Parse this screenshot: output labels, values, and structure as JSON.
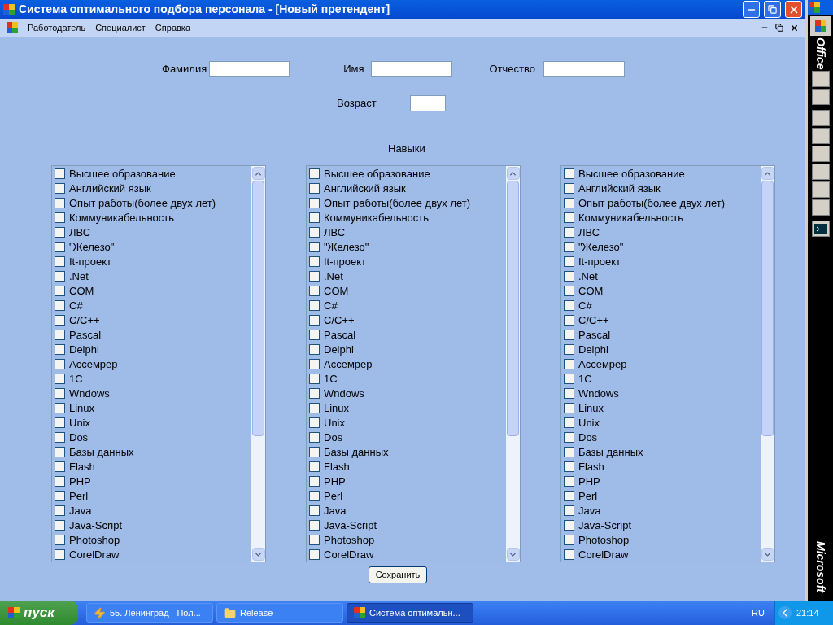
{
  "window": {
    "title": "Система оптимального подбора персонала - [Новый претендент]"
  },
  "menu": [
    {
      "label": "Работодатель"
    },
    {
      "label": "Специалист"
    },
    {
      "label": "Справка"
    }
  ],
  "form": {
    "fields": [
      {
        "label": "Фамилия"
      },
      {
        "label": "Имя"
      },
      {
        "label": "Отчество"
      }
    ],
    "age": {
      "label": "Возраст"
    },
    "skills_label": "Навыки",
    "skill_lists": [
      {
        "items": [
          {
            "label": "Высшее образование",
            "checked": false
          },
          {
            "label": "Английский язык",
            "checked": false
          },
          {
            "label": "Опыт работы(более двух лет)",
            "checked": false
          },
          {
            "label": "Коммуникабельность",
            "checked": false
          },
          {
            "label": "ЛВС",
            "checked": false
          },
          {
            "label": "\"Железо\"",
            "checked": false
          },
          {
            "label": "It-проект",
            "checked": false
          },
          {
            "label": ".Net",
            "checked": false
          },
          {
            "label": "COM",
            "checked": false
          },
          {
            "label": "C#",
            "checked": false
          },
          {
            "label": "C/C++",
            "checked": false
          },
          {
            "label": "Pascal",
            "checked": false
          },
          {
            "label": "Delphi",
            "checked": false
          },
          {
            "label": "Ассемрер",
            "checked": false
          },
          {
            "label": "1C",
            "checked": false
          },
          {
            "label": "Wndows",
            "checked": false
          },
          {
            "label": "Linux",
            "checked": false
          },
          {
            "label": "Unix",
            "checked": false
          },
          {
            "label": "Dos",
            "checked": false
          },
          {
            "label": "Базы данных",
            "checked": false
          },
          {
            "label": "Flash",
            "checked": false
          },
          {
            "label": "PHP",
            "checked": false
          },
          {
            "label": "Perl",
            "checked": false
          },
          {
            "label": "Java",
            "checked": false
          },
          {
            "label": "Java-Script",
            "checked": false
          },
          {
            "label": "Photoshop",
            "checked": false
          },
          {
            "label": "CorelDraw",
            "checked": false
          }
        ]
      },
      {
        "items": [
          {
            "label": "Высшее образование",
            "checked": false
          },
          {
            "label": "Английский язык",
            "checked": false
          },
          {
            "label": "Опыт работы(более двух лет)",
            "checked": false
          },
          {
            "label": "Коммуникабельность",
            "checked": false
          },
          {
            "label": "ЛВС",
            "checked": false
          },
          {
            "label": "\"Железо\"",
            "checked": false
          },
          {
            "label": "It-проект",
            "checked": false
          },
          {
            "label": ".Net",
            "checked": false
          },
          {
            "label": "COM",
            "checked": false
          },
          {
            "label": "C#",
            "checked": false
          },
          {
            "label": "C/C++",
            "checked": false
          },
          {
            "label": "Pascal",
            "checked": false
          },
          {
            "label": "Delphi",
            "checked": false
          },
          {
            "label": "Ассемрер",
            "checked": false
          },
          {
            "label": "1C",
            "checked": false
          },
          {
            "label": "Wndows",
            "checked": false
          },
          {
            "label": "Linux",
            "checked": false
          },
          {
            "label": "Unix",
            "checked": false
          },
          {
            "label": "Dos",
            "checked": false
          },
          {
            "label": "Базы данных",
            "checked": false
          },
          {
            "label": "Flash",
            "checked": false
          },
          {
            "label": "PHP",
            "checked": false
          },
          {
            "label": "Perl",
            "checked": false
          },
          {
            "label": "Java",
            "checked": false
          },
          {
            "label": "Java-Script",
            "checked": false
          },
          {
            "label": "Photoshop",
            "checked": false
          },
          {
            "label": "CorelDraw",
            "checked": false
          }
        ]
      },
      {
        "items": [
          {
            "label": "Высшее образование",
            "checked": false
          },
          {
            "label": "Английский язык",
            "checked": false
          },
          {
            "label": "Опыт работы(более двух лет)",
            "checked": false
          },
          {
            "label": "Коммуникабельность",
            "checked": false
          },
          {
            "label": "ЛВС",
            "checked": false
          },
          {
            "label": "\"Железо\"",
            "checked": false
          },
          {
            "label": "It-проект",
            "checked": false
          },
          {
            "label": ".Net",
            "checked": false
          },
          {
            "label": "COM",
            "checked": false
          },
          {
            "label": "C#",
            "checked": false
          },
          {
            "label": "C/C++",
            "checked": false
          },
          {
            "label": "Pascal",
            "checked": false
          },
          {
            "label": "Delphi",
            "checked": false
          },
          {
            "label": "Ассемрер",
            "checked": false
          },
          {
            "label": "1C",
            "checked": false
          },
          {
            "label": "Wndows",
            "checked": false
          },
          {
            "label": "Linux",
            "checked": false
          },
          {
            "label": "Unix",
            "checked": false
          },
          {
            "label": "Dos",
            "checked": false
          },
          {
            "label": "Базы данных",
            "checked": false
          },
          {
            "label": "Flash",
            "checked": false
          },
          {
            "label": "PHP",
            "checked": false
          },
          {
            "label": "Perl",
            "checked": false
          },
          {
            "label": "Java",
            "checked": false
          },
          {
            "label": "Java-Script",
            "checked": false
          },
          {
            "label": "Photoshop",
            "checked": false
          },
          {
            "label": "CorelDraw",
            "checked": false
          }
        ]
      }
    ],
    "save_button": "Сохранить"
  },
  "office_bar": {
    "title": "Office",
    "brand": "Microsoft"
  },
  "taskbar": {
    "start": "пуск",
    "tasks": [
      {
        "label": "55. Ленинград - Пол...",
        "kind": "media",
        "selected": false
      },
      {
        "label": "Release",
        "kind": "folder",
        "selected": false
      },
      {
        "label": "Система оптимальн...",
        "kind": "app",
        "selected": true
      }
    ],
    "language": "RU",
    "clock": "21:14"
  }
}
